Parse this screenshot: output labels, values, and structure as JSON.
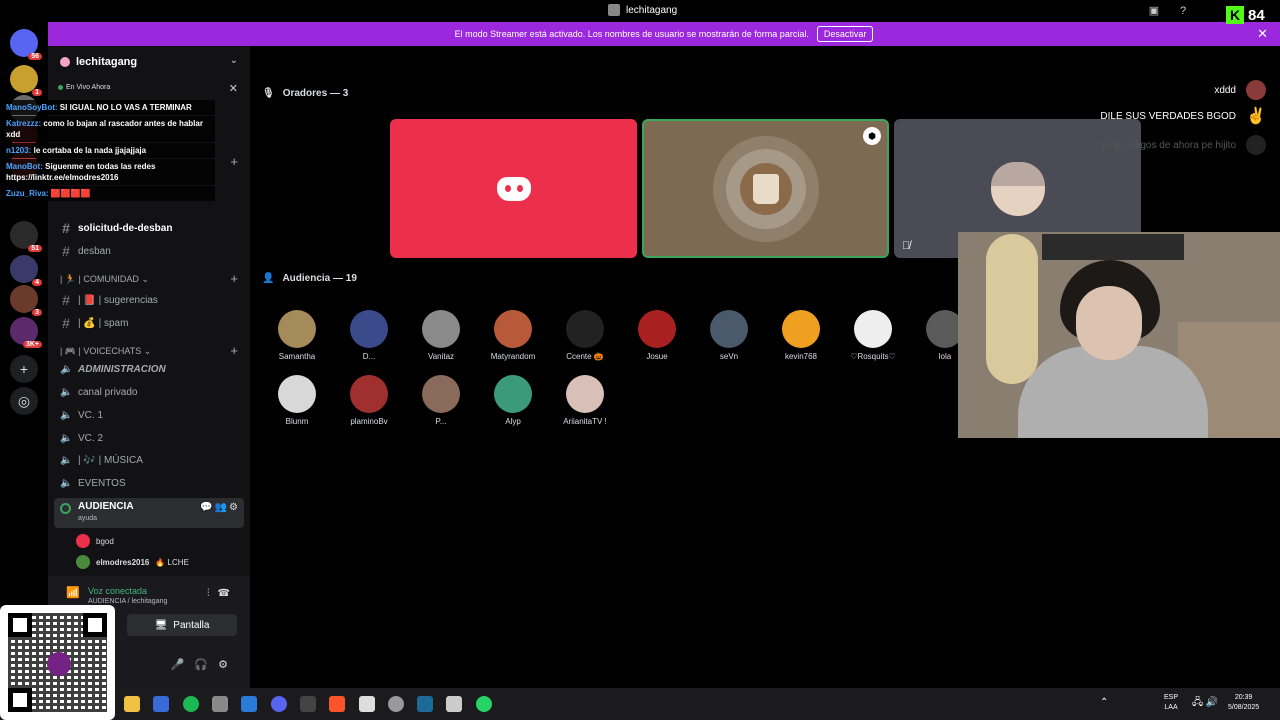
{
  "window": {
    "title": "lechitagang"
  },
  "kick": {
    "logo": "K",
    "count": "84"
  },
  "banner": {
    "text": "El modo Streamer está activado. Los nombres de usuario se mostrarán de forma parcial.",
    "button": "Desactivar",
    "close": "✕"
  },
  "servers": [
    {
      "badge": "56"
    },
    {
      "badge": "1"
    },
    {
      "badge": ""
    },
    {
      "badge": ""
    },
    {
      "badge": ""
    },
    {
      "badge": "51"
    },
    {
      "badge": "4"
    },
    {
      "badge": "3"
    },
    {
      "badge": "3K+"
    }
  ],
  "sidebar": {
    "guild": "lechitagang",
    "live_label": "En Vivo Ahora",
    "channels_top": [
      {
        "icon": "#",
        "label": "solicitud-de-desban",
        "bold": true
      },
      {
        "icon": "#",
        "label": "desban",
        "bold": false
      }
    ],
    "category_comunidad": "| 🏃 | COMUNIDAD ⌄",
    "channels_comunidad": [
      {
        "icon": "#",
        "label": "| 📕 | sugerencias"
      },
      {
        "icon": "#",
        "label": "| 💰 | spam"
      }
    ],
    "category_voice": "| 🎮 | VOICECHATS ⌄",
    "voice_channels": [
      {
        "label": "ADMINISTRACION"
      },
      {
        "label": "canal privado"
      },
      {
        "label": "VC. 1"
      },
      {
        "label": "VC. 2"
      },
      {
        "label": "| 🎶 | MÚSICA"
      },
      {
        "label": "EVENTOS"
      }
    ],
    "audience_channel": {
      "label": "AUDIENCIA",
      "sub": "ayuda"
    },
    "members": [
      {
        "name": "bgod",
        "tag": ""
      },
      {
        "name": "elmodres2016",
        "tag": "🔥 LCHE"
      }
    ]
  },
  "voice_panel": {
    "status": "Voz conectada",
    "location": "AUDIENCIA / lechitagang",
    "screen_button": "Pantalla"
  },
  "chat_overlay": [
    {
      "user": "ManoSoyBot:",
      "text": "SI IGUAL NO LO VAS A TERMINAR"
    },
    {
      "user": "Katrezzz:",
      "text": "como lo bajan al rascador antes de hablar xdd"
    },
    {
      "user": "n1203:",
      "text": "le cortaba de la nada jjajajjaja"
    },
    {
      "user": "ManoBot:",
      "text": "Siguenme en todas las redes https://linktr.ee/elmodres2016"
    },
    {
      "user": "Zuzu_Riva:",
      "text": "🟥🟥🟥🟥"
    }
  ],
  "speakers_header": "Oradores — 3",
  "audience_header": "Audiencia — 19",
  "audience": [
    {
      "name": "Samantha",
      "color": "#a58a5a"
    },
    {
      "name": "D...",
      "color": "#3a4a8a"
    },
    {
      "name": "Vanitaz",
      "color": "#8a8a8a"
    },
    {
      "name": "Matyrandom",
      "color": "#b85a3a"
    },
    {
      "name": "Ccente 🎃",
      "color": "#222222"
    },
    {
      "name": "Josue",
      "color": "#a82020"
    },
    {
      "name": "seVn",
      "color": "#4a5a6a"
    },
    {
      "name": "kevin768",
      "color": "#f0a020"
    },
    {
      "name": "♡Rosquits♡",
      "color": "#eeeeee"
    },
    {
      "name": "lola",
      "color": "#5a5a5a"
    },
    {
      "name": "Blunm",
      "color": "#d8d8d8"
    },
    {
      "name": "plaminoBv",
      "color": "#a03030"
    },
    {
      "name": "P...",
      "color": "#8a6a5a"
    },
    {
      "name": "Alyp",
      "color": "#3a9a7a"
    },
    {
      "name": "AriianitaTV !",
      "color": "#d8c0b8"
    }
  ],
  "right_messages": [
    {
      "text": "xddd"
    },
    {
      "text": "DILE SUS VERDADES BGOD"
    },
    {
      "text": "jurgo juegos de ahora pe hijito"
    }
  ],
  "tray": {
    "lang1": "ESP",
    "lang2": "LAA",
    "time": "20:39",
    "date": "5/08/2025"
  }
}
